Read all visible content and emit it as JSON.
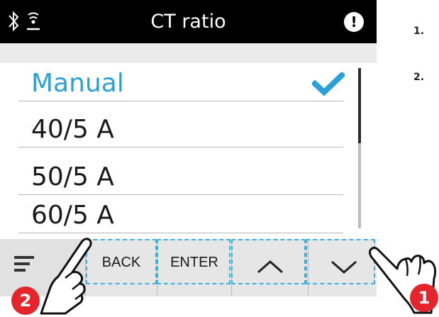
{
  "header": {
    "title": "CT ratio",
    "icons": [
      "bluetooth-icon",
      "signal-icon",
      "alert-icon"
    ],
    "alert_glyph": "!"
  },
  "list": {
    "items": [
      {
        "label": "Manual",
        "selected": true
      },
      {
        "label": "40/5 A",
        "selected": false
      },
      {
        "label": "50/5 A",
        "selected": false
      },
      {
        "label": "60/5 A",
        "selected": false
      }
    ]
  },
  "navbar": {
    "menu_icon": "menu-icon",
    "back_label": "BACK",
    "enter_label": "ENTER",
    "up_icon": "chevron-up-icon",
    "down_icon": "chevron-down-icon"
  },
  "callouts": [
    {
      "number": "1"
    },
    {
      "number": "2"
    }
  ],
  "steps": [
    "1.",
    "2."
  ],
  "colors": {
    "accent": "#2aa0d8",
    "highlight": "#3ab0e3",
    "badge": "#e4252b",
    "header_bg": "#000000"
  }
}
